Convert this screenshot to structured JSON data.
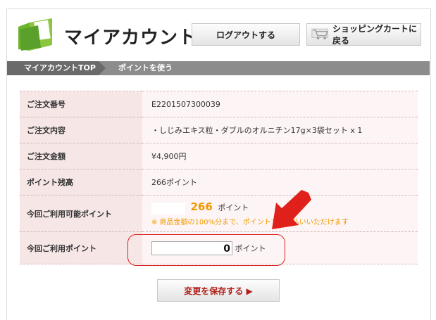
{
  "header": {
    "title": "マイアカウント",
    "logout_label": "ログアウトする",
    "cart_label": "ショッピングカートに戻る"
  },
  "breadcrumb": {
    "top": "マイアカウントTOP",
    "current": "ポイントを使う"
  },
  "order": {
    "rows": [
      {
        "label": "ご注文番号",
        "value": "E2201507300039"
      },
      {
        "label": "ご注文内容",
        "value": "・しじみエキス粒・ダブルのオルニチン17g×3袋セット x 1"
      },
      {
        "label": "ご注文金額",
        "value": "¥4,900円"
      },
      {
        "label": "ポイント残高",
        "value": "266ポイント"
      }
    ],
    "available_label": "今回ご利用可能ポイント",
    "available_points": "266",
    "available_unit": "ポイント",
    "available_note": "※ 商品金額の100%分まで、ポイントでお支払いいただけます",
    "use_label": "今回ご利用ポイント",
    "use_value": "0",
    "use_unit": "ポイント"
  },
  "save_label": "変更を保存する ▶",
  "colors": {
    "accent": "#f39800",
    "highlight": "#dd2222",
    "label_bg": "#f6e6e6"
  }
}
